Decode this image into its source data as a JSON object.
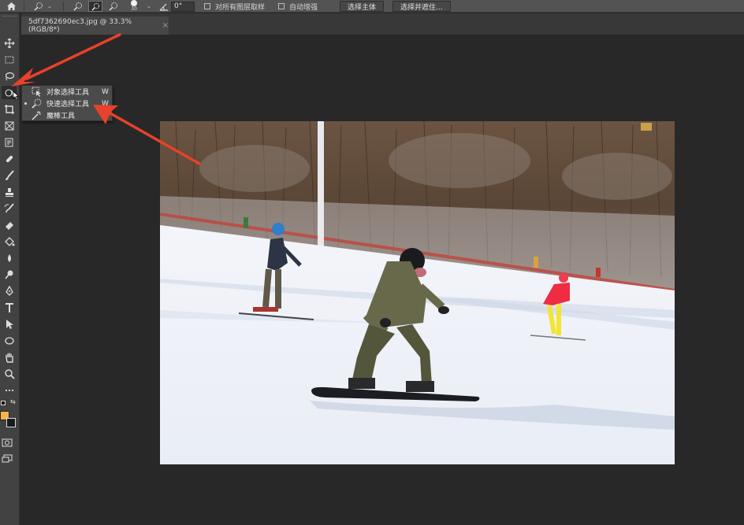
{
  "options_bar": {
    "brush_size": "30",
    "angle_value": "0°",
    "sample_all_layers_label": "对所有图层取样",
    "auto_enhance_label": "自动增强",
    "select_subject_label": "选择主体",
    "select_and_mask_label": "选择并遮住..."
  },
  "document_tab": {
    "title": "5df7362690ec3.jpg @ 33.3%(RGB/8*)",
    "close": "×"
  },
  "flyout": {
    "items": [
      {
        "label": "对象选择工具",
        "shortcut": "W",
        "icon": "object-selection-icon",
        "selected": false
      },
      {
        "label": "快速选择工具",
        "shortcut": "W",
        "icon": "quick-selection-icon",
        "selected": true
      },
      {
        "label": "魔棒工具",
        "shortcut": "",
        "icon": "magic-wand-icon",
        "selected": false
      }
    ]
  },
  "colors": {
    "foreground": "#f7b34b",
    "background": "#1a1a1a",
    "arrow": "#e8412c"
  },
  "toolbar": {
    "tools": [
      "move-icon",
      "marquee-icon",
      "lasso-icon",
      "quick-selection-icon",
      "crop-icon",
      "frame-icon",
      "eyedropper-icon",
      "healing-icon",
      "brush-icon",
      "stamp-icon",
      "history-brush-icon",
      "eraser-icon",
      "paint-bucket-icon",
      "blur-icon",
      "dodge-icon",
      "pen-icon",
      "type-icon",
      "path-selection-icon",
      "shape-icon",
      "hand-icon",
      "zoom-icon",
      "more-icon"
    ]
  }
}
